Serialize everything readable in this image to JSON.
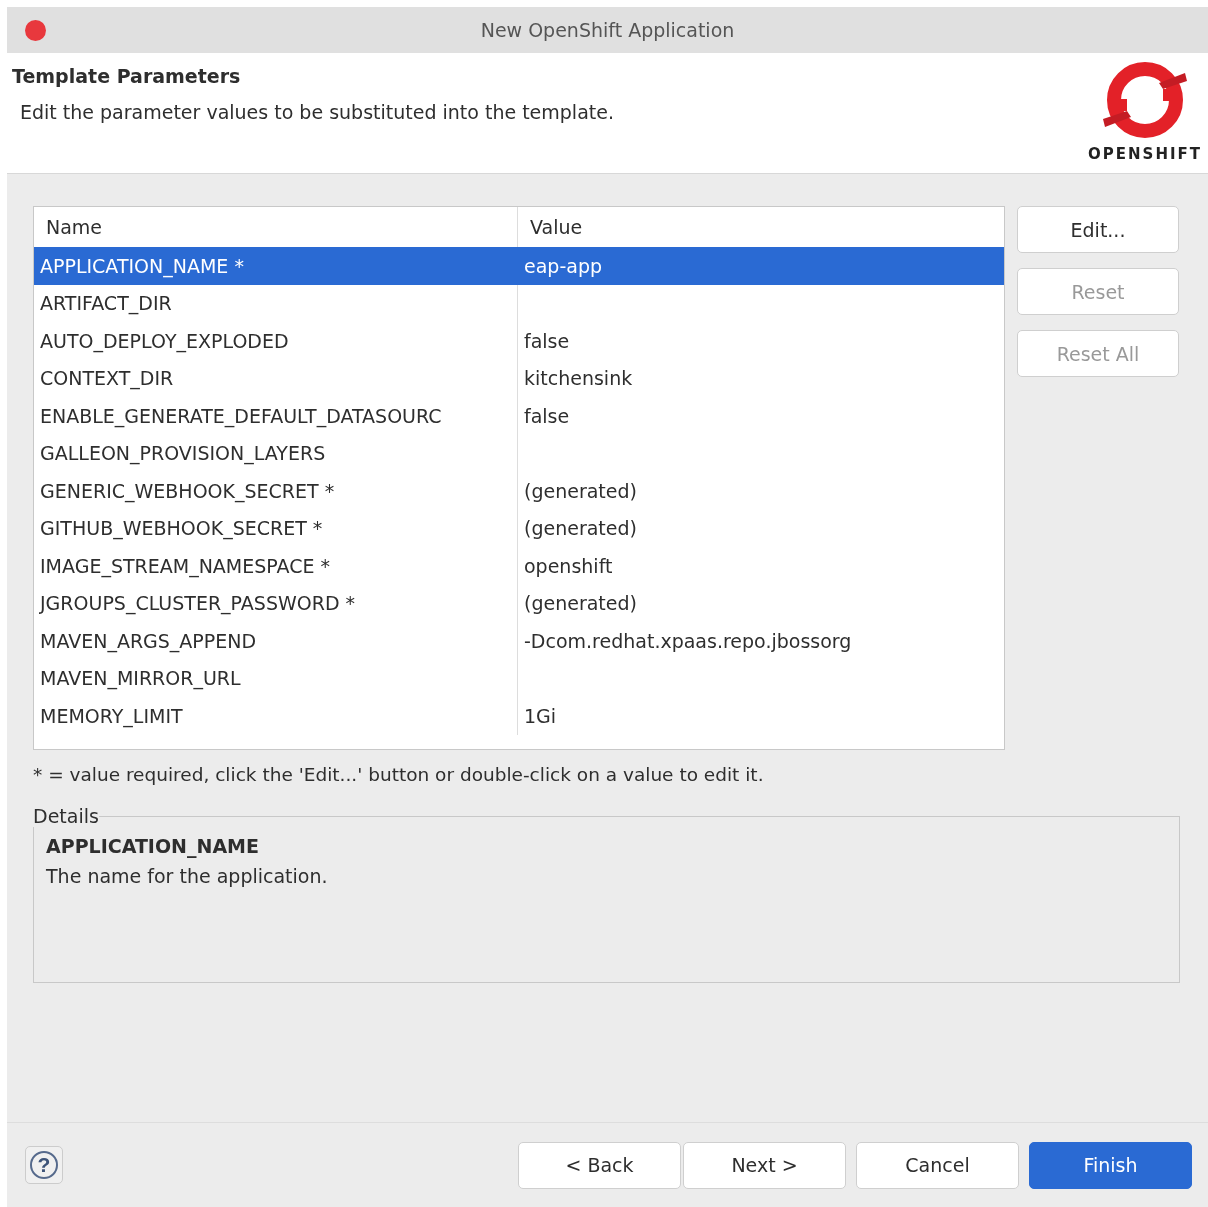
{
  "window": {
    "title": "New OpenShift Application"
  },
  "header": {
    "title": "Template Parameters",
    "description": "Edit the parameter values to be substituted into the template.",
    "logo_text": "OPENSHIFT"
  },
  "table": {
    "columns": [
      "Name",
      "Value"
    ],
    "rows": [
      {
        "name": "APPLICATION_NAME *",
        "value": "eap-app",
        "selected": true
      },
      {
        "name": "ARTIFACT_DIR",
        "value": "",
        "selected": false
      },
      {
        "name": "AUTO_DEPLOY_EXPLODED",
        "value": "false",
        "selected": false
      },
      {
        "name": "CONTEXT_DIR",
        "value": "kitchensink",
        "selected": false
      },
      {
        "name": "ENABLE_GENERATE_DEFAULT_DATASOURC",
        "value": "false",
        "selected": false
      },
      {
        "name": "GALLEON_PROVISION_LAYERS",
        "value": "",
        "selected": false
      },
      {
        "name": "GENERIC_WEBHOOK_SECRET *",
        "value": "(generated)",
        "selected": false
      },
      {
        "name": "GITHUB_WEBHOOK_SECRET *",
        "value": "(generated)",
        "selected": false
      },
      {
        "name": "IMAGE_STREAM_NAMESPACE *",
        "value": "openshift",
        "selected": false
      },
      {
        "name": "JGROUPS_CLUSTER_PASSWORD *",
        "value": "(generated)",
        "selected": false
      },
      {
        "name": "MAVEN_ARGS_APPEND",
        "value": "-Dcom.redhat.xpaas.repo.jbossorg",
        "selected": false
      },
      {
        "name": "MAVEN_MIRROR_URL",
        "value": "",
        "selected": false
      },
      {
        "name": "MEMORY_LIMIT",
        "value": "1Gi",
        "selected": false
      }
    ]
  },
  "side_buttons": [
    {
      "label": "Edit...",
      "disabled": false
    },
    {
      "label": "Reset",
      "disabled": true
    },
    {
      "label": "Reset All",
      "disabled": true
    }
  ],
  "hint": "* = value required, click the 'Edit...' button or double-click on a value to edit it.",
  "details": {
    "legend": "Details",
    "name": "APPLICATION_NAME",
    "description": "The name for the application."
  },
  "help_button": "?",
  "buttons": [
    {
      "label": "< Back",
      "primary": false
    },
    {
      "label": "Next >",
      "primary": false
    },
    {
      "label": "Cancel",
      "primary": false
    },
    {
      "label": "Finish",
      "primary": true
    }
  ]
}
